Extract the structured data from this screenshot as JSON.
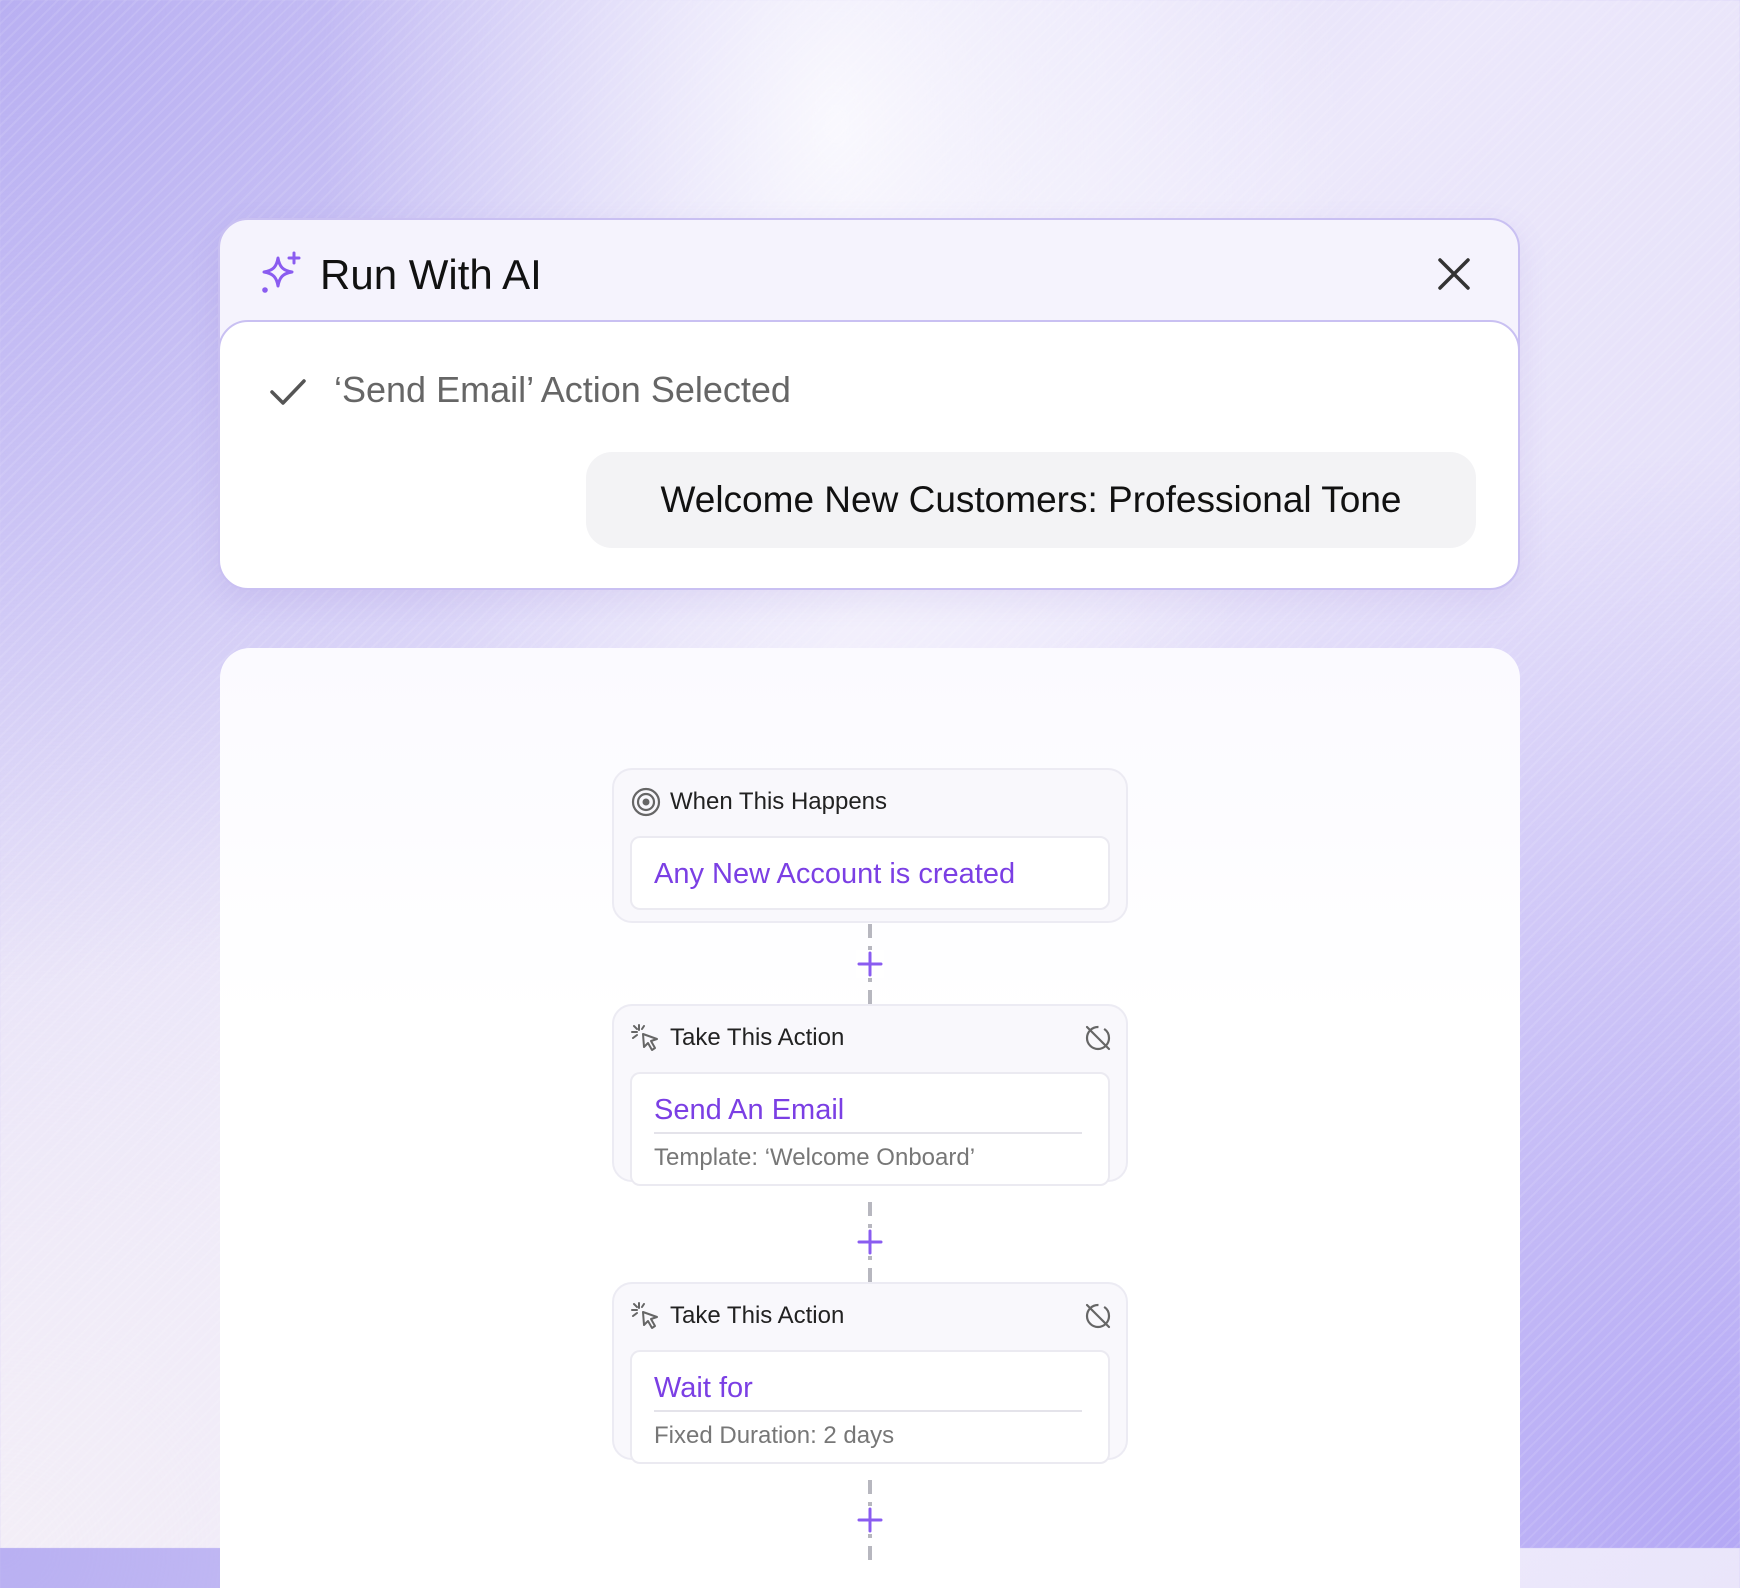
{
  "ai_panel": {
    "title": "Run With AI",
    "status": "‘Send Email’ Action Selected",
    "prompt": "Welcome New Customers: Professional Tone",
    "accent_color": "#8a5cf0"
  },
  "workflow": {
    "trigger": {
      "header": "When This Happens",
      "event": "Any New Account is created",
      "icon": "target-icon"
    },
    "actions": [
      {
        "header": "Take This Action",
        "title": "Send An Email",
        "detail": "Template: ‘Welcome Onboard’",
        "icon": "cursor-click-icon"
      },
      {
        "header": "Take This Action",
        "title": "Wait for",
        "detail": "Fixed Duration: 2 days",
        "icon": "cursor-click-icon"
      }
    ],
    "accent_color": "#7b3fe4"
  }
}
